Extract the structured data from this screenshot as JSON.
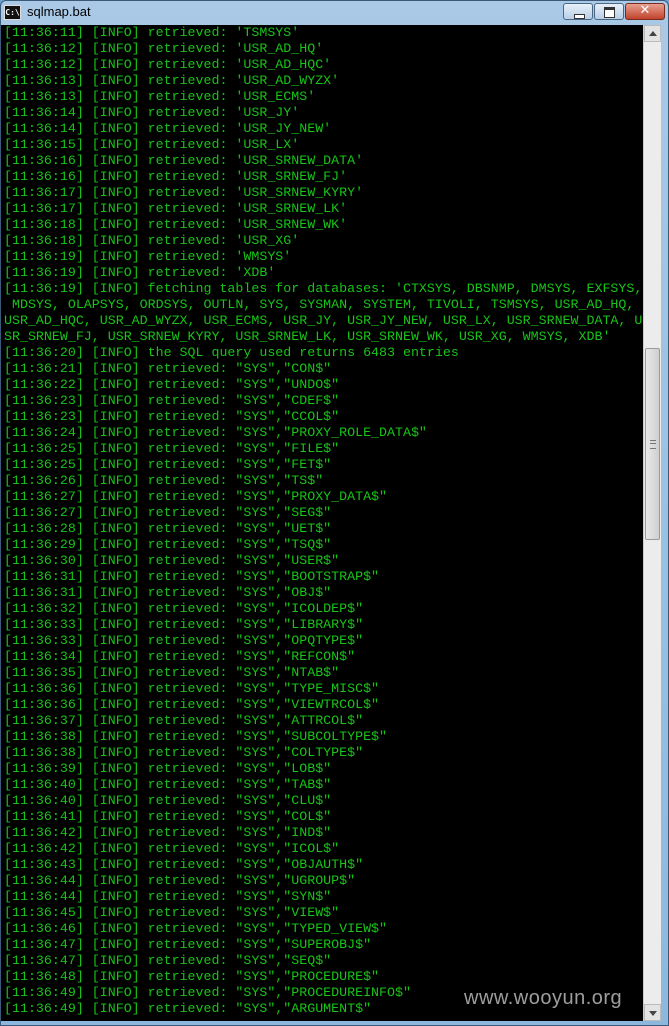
{
  "window": {
    "title": "sqlmap.bat",
    "icon_text": "C:\\"
  },
  "controls": {
    "close_label": "✕"
  },
  "watermark": "www.wooyun.org",
  "console_lines": [
    "[11:36:11] [INFO] retrieved: 'TSMSYS'",
    "[11:36:12] [INFO] retrieved: 'USR_AD_HQ'",
    "[11:36:12] [INFO] retrieved: 'USR_AD_HQC'",
    "[11:36:13] [INFO] retrieved: 'USR_AD_WYZX'",
    "[11:36:13] [INFO] retrieved: 'USR_ECMS'",
    "[11:36:14] [INFO] retrieved: 'USR_JY'",
    "[11:36:14] [INFO] retrieved: 'USR_JY_NEW'",
    "[11:36:15] [INFO] retrieved: 'USR_LX'",
    "[11:36:16] [INFO] retrieved: 'USR_SRNEW_DATA'",
    "[11:36:16] [INFO] retrieved: 'USR_SRNEW_FJ'",
    "[11:36:17] [INFO] retrieved: 'USR_SRNEW_KYRY'",
    "[11:36:17] [INFO] retrieved: 'USR_SRNEW_LK'",
    "[11:36:18] [INFO] retrieved: 'USR_SRNEW_WK'",
    "[11:36:18] [INFO] retrieved: 'USR_XG'",
    "[11:36:19] [INFO] retrieved: 'WMSYS'",
    "[11:36:19] [INFO] retrieved: 'XDB'",
    "[11:36:19] [INFO] fetching tables for databases: 'CTXSYS, DBSNMP, DMSYS, EXFSYS,",
    " MDSYS, OLAPSYS, ORDSYS, OUTLN, SYS, SYSMAN, SYSTEM, TIVOLI, TSMSYS, USR_AD_HQ,",
    "USR_AD_HQC, USR_AD_WYZX, USR_ECMS, USR_JY, USR_JY_NEW, USR_LX, USR_SRNEW_DATA, U",
    "SR_SRNEW_FJ, USR_SRNEW_KYRY, USR_SRNEW_LK, USR_SRNEW_WK, USR_XG, WMSYS, XDB'",
    "[11:36:20] [INFO] the SQL query used returns 6483 entries",
    "[11:36:21] [INFO] retrieved: \"SYS\",\"CON$\"",
    "[11:36:22] [INFO] retrieved: \"SYS\",\"UNDO$\"",
    "[11:36:23] [INFO] retrieved: \"SYS\",\"CDEF$\"",
    "[11:36:23] [INFO] retrieved: \"SYS\",\"CCOL$\"",
    "[11:36:24] [INFO] retrieved: \"SYS\",\"PROXY_ROLE_DATA$\"",
    "[11:36:25] [INFO] retrieved: \"SYS\",\"FILE$\"",
    "[11:36:25] [INFO] retrieved: \"SYS\",\"FET$\"",
    "[11:36:26] [INFO] retrieved: \"SYS\",\"TS$\"",
    "[11:36:27] [INFO] retrieved: \"SYS\",\"PROXY_DATA$\"",
    "[11:36:27] [INFO] retrieved: \"SYS\",\"SEG$\"",
    "[11:36:28] [INFO] retrieved: \"SYS\",\"UET$\"",
    "[11:36:29] [INFO] retrieved: \"SYS\",\"TSQ$\"",
    "[11:36:30] [INFO] retrieved: \"SYS\",\"USER$\"",
    "[11:36:31] [INFO] retrieved: \"SYS\",\"BOOTSTRAP$\"",
    "[11:36:31] [INFO] retrieved: \"SYS\",\"OBJ$\"",
    "[11:36:32] [INFO] retrieved: \"SYS\",\"ICOLDEP$\"",
    "[11:36:33] [INFO] retrieved: \"SYS\",\"LIBRARY$\"",
    "[11:36:33] [INFO] retrieved: \"SYS\",\"OPQTYPE$\"",
    "[11:36:34] [INFO] retrieved: \"SYS\",\"REFCON$\"",
    "[11:36:35] [INFO] retrieved: \"SYS\",\"NTAB$\"",
    "[11:36:36] [INFO] retrieved: \"SYS\",\"TYPE_MISC$\"",
    "[11:36:36] [INFO] retrieved: \"SYS\",\"VIEWTRCOL$\"",
    "[11:36:37] [INFO] retrieved: \"SYS\",\"ATTRCOL$\"",
    "[11:36:38] [INFO] retrieved: \"SYS\",\"SUBCOLTYPE$\"",
    "[11:36:38] [INFO] retrieved: \"SYS\",\"COLTYPE$\"",
    "[11:36:39] [INFO] retrieved: \"SYS\",\"LOB$\"",
    "[11:36:40] [INFO] retrieved: \"SYS\",\"TAB$\"",
    "[11:36:40] [INFO] retrieved: \"SYS\",\"CLU$\"",
    "[11:36:41] [INFO] retrieved: \"SYS\",\"COL$\"",
    "[11:36:42] [INFO] retrieved: \"SYS\",\"IND$\"",
    "[11:36:42] [INFO] retrieved: \"SYS\",\"ICOL$\"",
    "[11:36:43] [INFO] retrieved: \"SYS\",\"OBJAUTH$\"",
    "[11:36:44] [INFO] retrieved: \"SYS\",\"UGROUP$\"",
    "[11:36:44] [INFO] retrieved: \"SYS\",\"SYN$\"",
    "[11:36:45] [INFO] retrieved: \"SYS\",\"VIEW$\"",
    "[11:36:46] [INFO] retrieved: \"SYS\",\"TYPED_VIEW$\"",
    "[11:36:47] [INFO] retrieved: \"SYS\",\"SUPEROBJ$\"",
    "[11:36:47] [INFO] retrieved: \"SYS\",\"SEQ$\"",
    "[11:36:48] [INFO] retrieved: \"SYS\",\"PROCEDURE$\"",
    "[11:36:49] [INFO] retrieved: \"SYS\",\"PROCEDUREINFO$\"",
    "[11:36:49] [INFO] retrieved: \"SYS\",\"ARGUMENT$\""
  ]
}
